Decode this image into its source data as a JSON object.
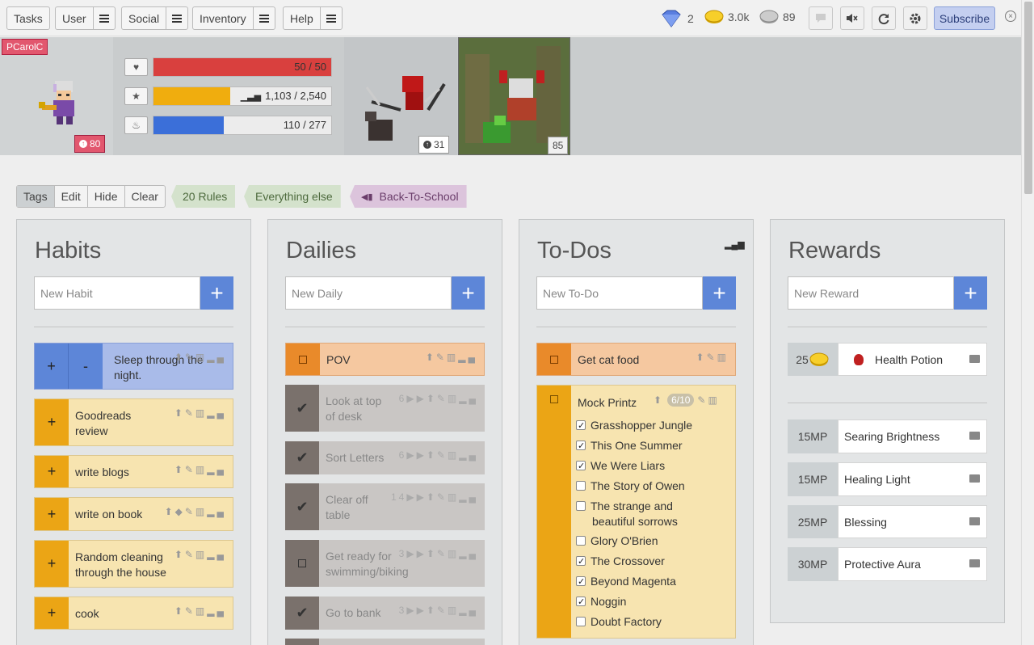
{
  "nav": {
    "menus": [
      "Tasks",
      "User",
      "Social",
      "Inventory",
      "Help"
    ],
    "gems": "2",
    "gold": "3.0k",
    "silver": "89",
    "subscribe": "Subscribe",
    "icons": [
      "chat-icon",
      "mute-icon",
      "refresh-icon",
      "gear-icon",
      "close-icon"
    ]
  },
  "user": {
    "name": "PCarolC",
    "level": "80",
    "health": {
      "text": "50 / 50",
      "fraction": 1.0,
      "color": "#d9403e"
    },
    "experience": {
      "text": "1,103 / 2,540",
      "fraction": 0.434,
      "color": "#f0ad0e"
    },
    "mana": {
      "text": "110 / 277",
      "fraction": 0.397,
      "color": "#3b6fd9"
    },
    "mount_level": "31",
    "pet_level": "85"
  },
  "tags": {
    "buttons": [
      "Tags",
      "Edit",
      "Hide",
      "Clear"
    ],
    "pills": [
      {
        "label": "20 Rules",
        "bg": "#d4e2cc",
        "fg": "#4d6a3d"
      },
      {
        "label": "Everything else",
        "bg": "#d4e2cc",
        "fg": "#4d6a3d"
      },
      {
        "label": "Back-To-School",
        "bg": "#dcc4dc",
        "fg": "#6a3d6a"
      }
    ]
  },
  "habits": {
    "title": "Habits",
    "placeholder": "New Habit",
    "items": [
      "Sleep through the night.",
      "Goodreads review",
      "write blogs",
      "write on book",
      "Random cleaning through the house",
      "cook"
    ]
  },
  "dailies": {
    "title": "Dailies",
    "placeholder": "New Daily",
    "items": [
      {
        "label": "POV",
        "streak": ""
      },
      {
        "label": "Look at top of desk",
        "streak": "6"
      },
      {
        "label": "Sort Letters",
        "streak": "6"
      },
      {
        "label": "Clear off table",
        "streak": "14"
      },
      {
        "label": "Get ready for swimming/biking",
        "streak": "3"
      },
      {
        "label": "Go to bank",
        "streak": "3"
      }
    ]
  },
  "todos": {
    "title": "To-Dos",
    "placeholder": "New To-Do",
    "items": [
      "Get cat food",
      "Mock Printz"
    ],
    "progress": "6/10",
    "checklist": [
      {
        "label": "Grasshopper Jungle",
        "done": true
      },
      {
        "label": "This One Summer",
        "done": true
      },
      {
        "label": "We Were Liars",
        "done": true
      },
      {
        "label": "The Story of Owen",
        "done": false
      },
      {
        "label": "The strange and beautiful sorrows",
        "done": false
      },
      {
        "label": "Glory O'Brien",
        "done": false
      },
      {
        "label": "The Crossover",
        "done": true
      },
      {
        "label": "Beyond Magenta",
        "done": true
      },
      {
        "label": "Noggin",
        "done": true
      },
      {
        "label": "Doubt Factory",
        "done": false
      }
    ]
  },
  "rewards": {
    "title": "Rewards",
    "placeholder": "New Reward",
    "items": [
      {
        "cost": "25",
        "label": "Health Potion"
      },
      {
        "cost": "15MP",
        "label": "Searing Brightness"
      },
      {
        "cost": "15MP",
        "label": "Healing Light"
      },
      {
        "cost": "25MP",
        "label": "Blessing"
      },
      {
        "cost": "30MP",
        "label": "Protective Aura"
      }
    ]
  }
}
